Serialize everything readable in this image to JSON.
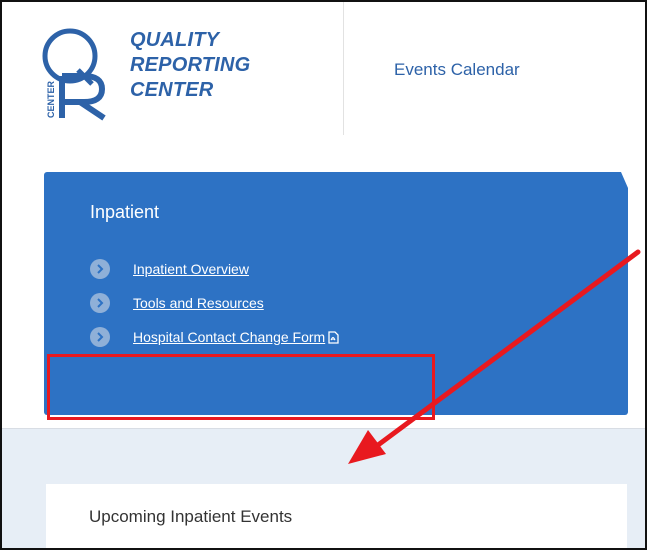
{
  "brand": {
    "line1": "QUALITY",
    "line2": "REPORTING",
    "line3": "CENTER",
    "mark_side_text": "CENTER",
    "color": "#2d62a8"
  },
  "header": {
    "nav_events": "Events Calendar"
  },
  "panel": {
    "title": "Inpatient",
    "color": "#2d72c4",
    "links": [
      {
        "label": "Inpatient Overview",
        "icon": "chevron-right-icon"
      },
      {
        "label": "Tools and Resources",
        "icon": "chevron-right-icon"
      },
      {
        "label": "Hospital Contact Change Form",
        "icon": "chevron-right-icon",
        "trailing_icon": "pdf-icon"
      }
    ]
  },
  "events": {
    "title": "Upcoming Inpatient Events",
    "highlight_color": "#e8191f"
  },
  "annotation": {
    "arrow_color": "#e8191f"
  }
}
